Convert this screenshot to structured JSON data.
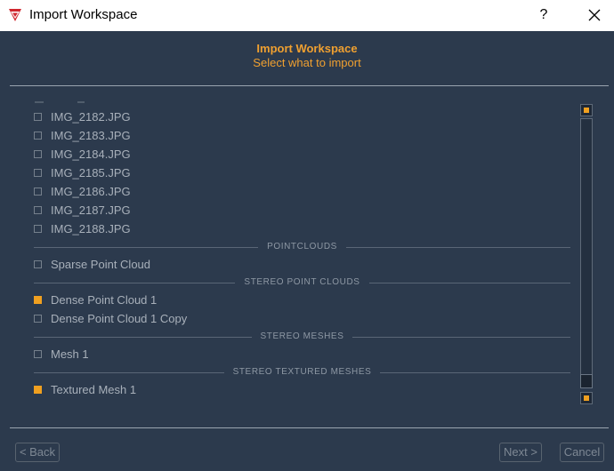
{
  "window": {
    "title": "Import Workspace",
    "help_label": "?",
    "close_label": "×"
  },
  "header": {
    "title": "Import Workspace",
    "subtitle": "Select what to import"
  },
  "images": [
    {
      "label": "IMG_2182.JPG",
      "checked": false
    },
    {
      "label": "IMG_2183.JPG",
      "checked": false
    },
    {
      "label": "IMG_2184.JPG",
      "checked": false
    },
    {
      "label": "IMG_2185.JPG",
      "checked": false
    },
    {
      "label": "IMG_2186.JPG",
      "checked": false
    },
    {
      "label": "IMG_2187.JPG",
      "checked": false
    },
    {
      "label": "IMG_2188.JPG",
      "checked": false
    }
  ],
  "sections": {
    "pointclouds": "POINTCLOUDS",
    "stereo_point_clouds": "STEREO POINT CLOUDS",
    "stereo_meshes": "STEREO MESHES",
    "stereo_textured_meshes": "STEREO TEXTURED MESHES"
  },
  "items": {
    "sparse_point_cloud": {
      "label": "Sparse Point Cloud",
      "checked": false
    },
    "dense_point_cloud_1": {
      "label": "Dense Point Cloud 1",
      "checked": true
    },
    "dense_point_cloud_1_copy": {
      "label": "Dense Point Cloud 1 Copy",
      "checked": false
    },
    "mesh_1": {
      "label": "Mesh 1",
      "checked": false
    },
    "textured_mesh_1": {
      "label": "Textured Mesh 1",
      "checked": true
    }
  },
  "scroll": {
    "position": 0.97
  },
  "footer": {
    "back_label": "< Back",
    "next_label": "Next >",
    "cancel_label": "Cancel"
  },
  "colors": {
    "accent": "#f0a020",
    "background": "#2c3a4d",
    "header_text": "#f0a030",
    "item_text": "#a8b0ba"
  }
}
